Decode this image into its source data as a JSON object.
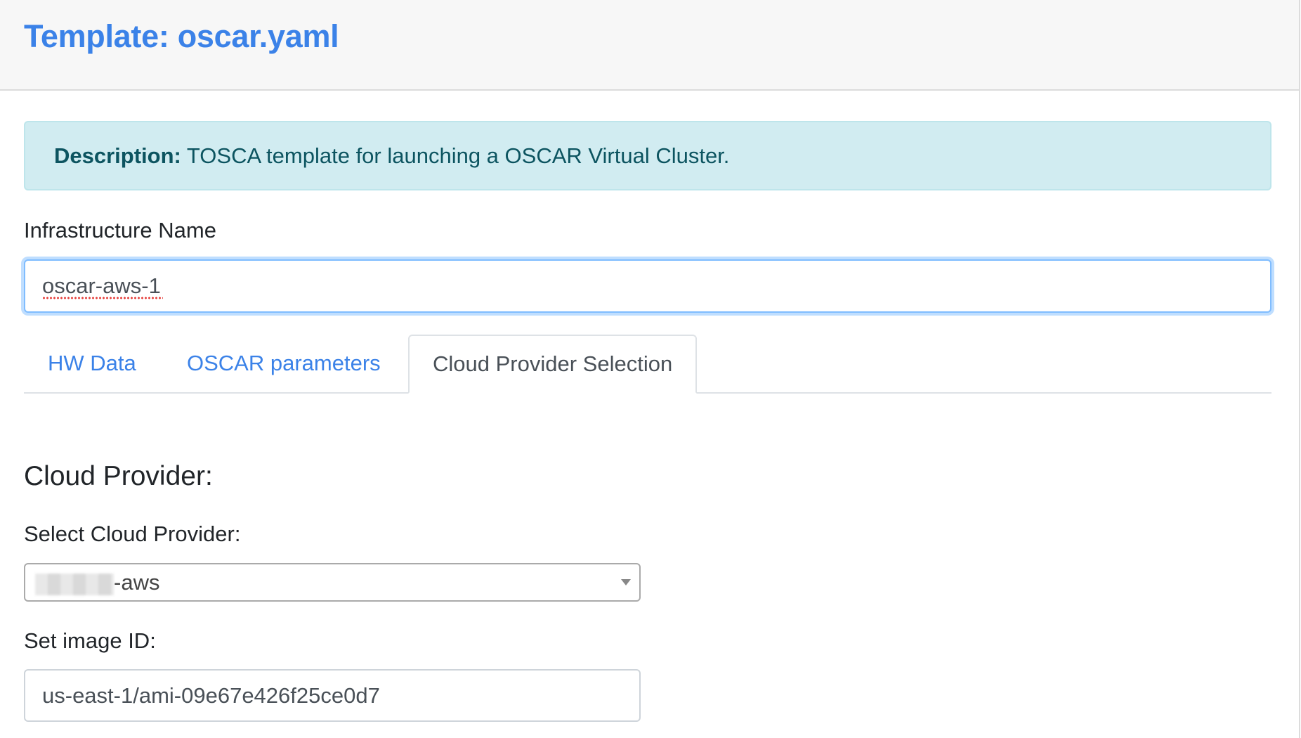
{
  "header": {
    "title": "Template: oscar.yaml"
  },
  "description": {
    "label": "Description:",
    "text": "TOSCA template for launching a OSCAR Virtual Cluster."
  },
  "infrastructure": {
    "label": "Infrastructure Name",
    "value": "oscar-aws-1"
  },
  "tabs": [
    {
      "label": "HW Data",
      "active": false
    },
    {
      "label": "OSCAR parameters",
      "active": false
    },
    {
      "label": "Cloud Provider Selection",
      "active": true
    }
  ],
  "cloud_provider": {
    "heading": "Cloud Provider:",
    "select_label": "Select Cloud Provider:",
    "select_value": "-aws",
    "image_label": "Set image ID:",
    "image_value": "us-east-1/ami-09e67e426f25ce0d7"
  },
  "colors": {
    "link": "#3b82e8",
    "alert_bg": "#d1ecf1",
    "alert_text": "#0c5460",
    "focus_border": "#80bdff"
  }
}
